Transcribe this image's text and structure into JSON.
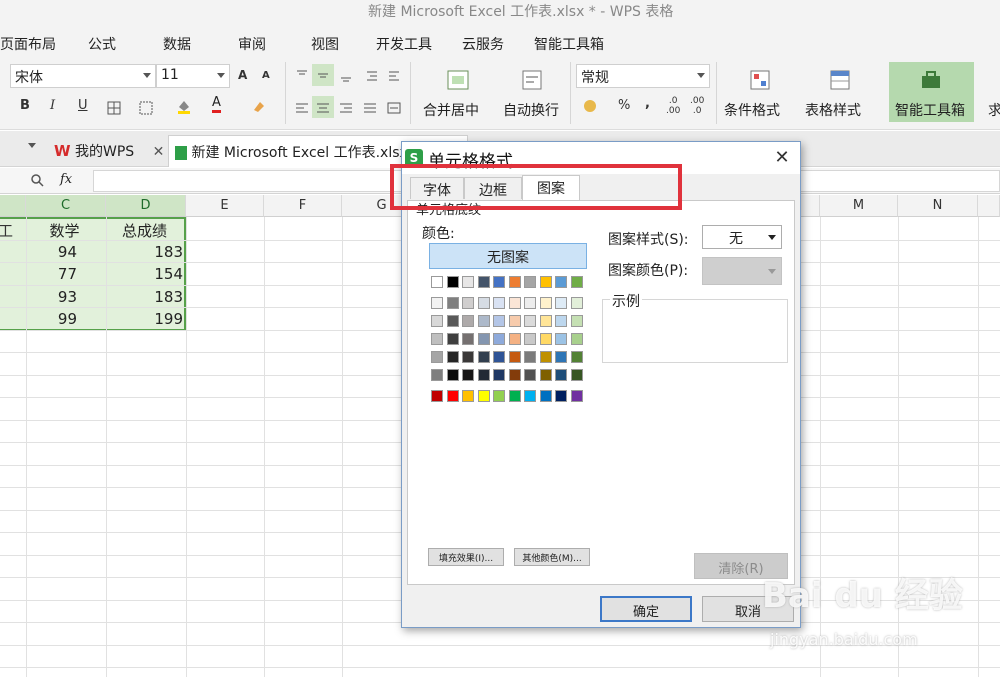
{
  "window": {
    "title": "新建 Microsoft Excel 工作表.xlsx * - WPS 表格"
  },
  "menu": [
    "页面布局",
    "公式",
    "数据",
    "审阅",
    "视图",
    "开发工具",
    "云服务",
    "智能工具箱"
  ],
  "ribbon": {
    "font_name": "宋体",
    "font_size": "11",
    "merge_label": "合并居中",
    "wrap_label": "自动换行",
    "number_format": "常规",
    "conditional_format": "条件格式",
    "table_style": "表格样式",
    "smart_toolbox": "智能工具箱",
    "sum_partial": "求",
    "percent": "%",
    "comma": ",",
    "dec_inc": ".0\n.00",
    "dec_dec": ".00\n.0",
    "bold": "B",
    "italic": "I",
    "underline": "U",
    "grow_font": "A",
    "shrink_font": "A",
    "font_color": "A"
  },
  "tabs": {
    "wps_tab": "我的WPS",
    "file_tab": "新建 Microsoft Excel 工作表.xlsx"
  },
  "formula_bar": {
    "fx": "fx"
  },
  "sheet": {
    "columns": [
      "C",
      "D",
      "E",
      "F",
      "G",
      "M",
      "N"
    ],
    "partial_col_header": "工",
    "headers": [
      "数学",
      "总成绩"
    ],
    "rows": [
      [
        "94",
        "183"
      ],
      [
        "77",
        "154"
      ],
      [
        "93",
        "183"
      ],
      [
        "99",
        "199"
      ]
    ]
  },
  "dialog": {
    "title": "单元格格式",
    "tabs": [
      "字体",
      "边框",
      "图案"
    ],
    "active_tab": "图案",
    "section": "单元格底纹",
    "color_label": "颜色:",
    "no_pattern": "无图案",
    "fill_effects": "填充效果(I)...",
    "more_colors": "其他颜色(M)...",
    "pattern_style_label": "图案样式(S):",
    "pattern_style_value": "无",
    "pattern_color_label": "图案颜色(P):",
    "sample_label": "示例",
    "clear": "清除(R)",
    "ok": "确定",
    "cancel": "取消",
    "swatch_rows": [
      [
        "#ffffff",
        "#000000",
        "#e7e6e6",
        "#44546a",
        "#4472c4",
        "#ed7d31",
        "#a5a5a5",
        "#ffc000",
        "#5b9bd5",
        "#70ad47"
      ],
      [
        "#f2f2f2",
        "#7f7f7f",
        "#d0cece",
        "#d6dce4",
        "#d9e2f3",
        "#fbe5d6",
        "#ededed",
        "#fff2cc",
        "#deebf6",
        "#e2efd9"
      ],
      [
        "#d8d8d8",
        "#595959",
        "#aeaaaa",
        "#adb9ca",
        "#b4c6e7",
        "#f7cbac",
        "#dbdbdb",
        "#ffe598",
        "#bdd7ee",
        "#c5e0b3"
      ],
      [
        "#bfbfbf",
        "#3f3f3f",
        "#757070",
        "#8496b0",
        "#8eaadb",
        "#f4b183",
        "#c9c9c9",
        "#ffd965",
        "#9cc3e5",
        "#a8d08d"
      ],
      [
        "#a5a5a5",
        "#262626",
        "#3a3838",
        "#323f4f",
        "#2f5496",
        "#c55a11",
        "#7b7b7b",
        "#bf9000",
        "#2e75b5",
        "#538135"
      ],
      [
        "#7f7f7f",
        "#0c0c0c",
        "#171616",
        "#222a35",
        "#1f3864",
        "#833c0b",
        "#525252",
        "#7f6000",
        "#1e4e79",
        "#375623"
      ],
      [
        "#c00000",
        "#ff0000",
        "#ffc000",
        "#ffff00",
        "#92d050",
        "#00b050",
        "#00b0f0",
        "#0070c0",
        "#002060",
        "#7030a0"
      ]
    ]
  },
  "watermark": {
    "brand": "Bai du 经验",
    "url": "jingyan.baidu.com"
  }
}
